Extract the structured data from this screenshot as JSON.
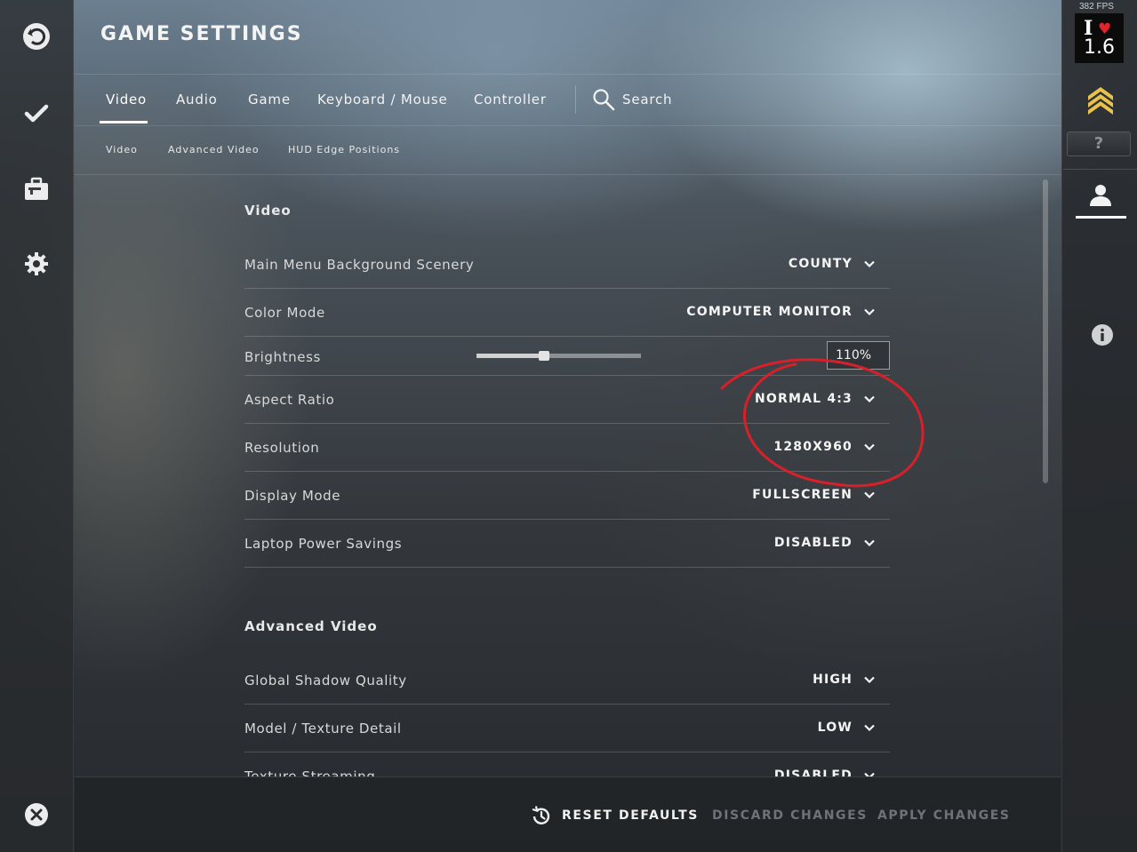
{
  "header": {
    "title": "GAME SETTINGS",
    "tabs": [
      {
        "label": "Video",
        "active": true
      },
      {
        "label": "Audio"
      },
      {
        "label": "Game"
      },
      {
        "label": "Keyboard / Mouse"
      },
      {
        "label": "Controller"
      }
    ],
    "search_label": "Search",
    "subtabs": [
      {
        "label": "Video"
      },
      {
        "label": "Advanced Video"
      },
      {
        "label": "HUD Edge Positions"
      }
    ]
  },
  "left_rail": {
    "icons": [
      "back-icon",
      "checkmark-icon",
      "briefcase-icon",
      "gear-icon",
      "close-icon"
    ]
  },
  "right_rail": {
    "fps": "382 FPS",
    "avatar_text_line1": "I",
    "avatar_text_line2": "1.6",
    "question_badge": "?",
    "icons": [
      "rank-chevrons-icon",
      "profile-icon",
      "info-icon"
    ]
  },
  "video_section": {
    "title": "Video",
    "rows": [
      {
        "label": "Main Menu Background Scenery",
        "value": "COUNTY"
      },
      {
        "label": "Color Mode",
        "value": "COMPUTER MONITOR"
      },
      {
        "label": "Brightness",
        "value": "110%",
        "slider_fraction": 0.41
      },
      {
        "label": "Aspect Ratio",
        "value": "NORMAL 4:3"
      },
      {
        "label": "Resolution",
        "value": "1280X960"
      },
      {
        "label": "Display Mode",
        "value": "FULLSCREEN"
      },
      {
        "label": "Laptop Power Savings",
        "value": "DISABLED"
      }
    ]
  },
  "advanced_section": {
    "title": "Advanced Video",
    "rows": [
      {
        "label": "Global Shadow Quality",
        "value": "HIGH"
      },
      {
        "label": "Model / Texture Detail",
        "value": "LOW"
      },
      {
        "label": "Texture Streaming",
        "value": "DISABLED"
      }
    ]
  },
  "footer": {
    "reset_label": "RESET DEFAULTS",
    "discard_label": "DISCARD CHANGES",
    "apply_label": "APPLY CHANGES"
  },
  "colors": {
    "annotation": "#d8202a",
    "accent": "#ffffff",
    "dim_text": "#6f7378"
  }
}
